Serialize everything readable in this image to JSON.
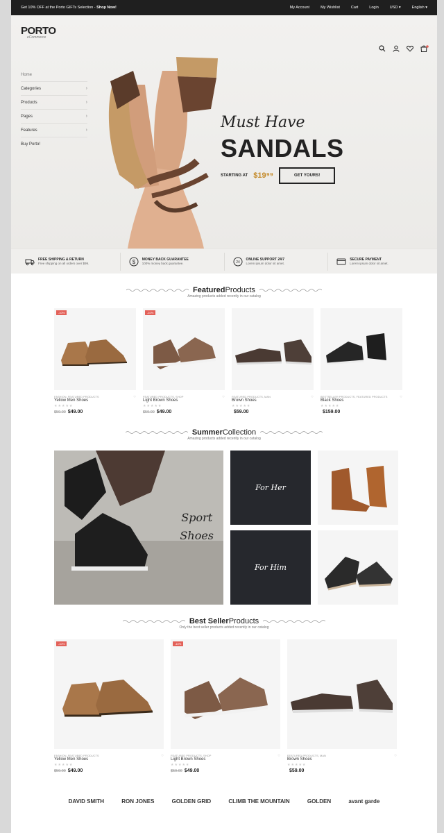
{
  "topbar": {
    "promo": "Get 10% OFF at the Porto GIFTs Selection - ",
    "promo_link": "Shop Now!",
    "links": [
      "My Account",
      "My Wishlist",
      "Cart",
      "Login",
      "USD ▾",
      "English ▾"
    ]
  },
  "logo": {
    "name": "PORTO",
    "sub": "eCommerce"
  },
  "menu": {
    "home": "Home",
    "items": [
      "Categories",
      "Products",
      "Pages",
      "Features",
      "Buy Porto!"
    ]
  },
  "hero": {
    "must_have": "Must Have",
    "title": "SANDALS",
    "starting": "STARTING AT",
    "price": "$19⁹⁹",
    "button": "GET YOURS!"
  },
  "features": [
    {
      "title": "FREE SHIPPING & RETURN",
      "sub": "Free shipping on all orders over $99.",
      "icon": "truck-icon"
    },
    {
      "title": "MONEY BACK GUARANTEE",
      "sub": "100% money back guarantee.",
      "icon": "dollar-icon"
    },
    {
      "title": "ONLINE SUPPORT 24/7",
      "sub": "Lorem ipsum dolor sit amet.",
      "icon": "support-icon"
    },
    {
      "title": "SECURE PAYMENT",
      "sub": "Lorem ipsum dolor sit amet.",
      "icon": "card-icon"
    }
  ],
  "featured": {
    "title_bold": "Featured",
    "title_rest": "Products",
    "sub": "Amazing products added recently in our catalog",
    "products": [
      {
        "badge": "-10%",
        "cat": "FASHION, FEATURED PRODUCTS",
        "name": "Yellow Men Shoes",
        "old": "$59.00",
        "price": "$49.00"
      },
      {
        "badge": "-10%",
        "cat": "FEATURED PRODUCTS, SHOP",
        "name": "Light Brown Shoes",
        "old": "$59.00",
        "price": "$49.00"
      },
      {
        "badge": "",
        "cat": "FEATURED PRODUCTS, MAN",
        "name": "Brown Shoes",
        "old": "",
        "price": "$59.00"
      },
      {
        "badge": "",
        "cat": "BESTSELLER PRODUCTS, FEATURED PRODUCTS",
        "name": "Black Shoes",
        "old": "",
        "price": "$159.00"
      }
    ]
  },
  "summer": {
    "title_bold": "Summer",
    "title_rest": "Collection",
    "sub": "Amazing products added recently in our catalog",
    "sport_1": "Sport",
    "sport_2": "Shoes",
    "for_her": "For Her",
    "for_him": "For Him"
  },
  "best": {
    "title_bold": "Best Seller",
    "title_rest": "Products",
    "sub": "Only the best seller products added recently in our catalog",
    "products": [
      {
        "badge": "-10%",
        "cat": "FASHION, FEATURED PRODUCTS",
        "name": "Yellow Men Shoes",
        "old": "$59.00",
        "price": "$49.00"
      },
      {
        "badge": "-10%",
        "cat": "FEATURED PRODUCTS, SHOP",
        "name": "Light Brown Shoes",
        "old": "$59.00",
        "price": "$49.00"
      },
      {
        "badge": "",
        "cat": "FEATURED PRODUCTS, MAN",
        "name": "Brown Shoes",
        "old": "",
        "price": "$59.00"
      }
    ]
  },
  "brands": [
    "DAVID SMITH",
    "RON JONES",
    "GOLDEN GRID",
    "CLIMB THE MOUNTAIN",
    "GOLDEN",
    "avant garde"
  ],
  "stars": "★★★★★",
  "colors": {
    "accent": "#e36159",
    "dark_tile": "#26282d",
    "price_accent": "#c48a2a"
  }
}
